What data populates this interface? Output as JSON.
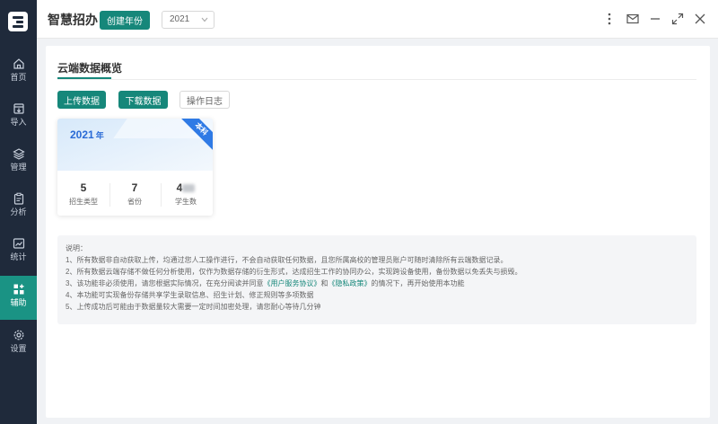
{
  "app": {
    "title": "智慧招办",
    "create_year_label": "创建年份",
    "year_select": "2021"
  },
  "sidebar": {
    "items": [
      {
        "label": "首页",
        "icon": "home-icon"
      },
      {
        "label": "导入",
        "icon": "import-icon"
      },
      {
        "label": "管理",
        "icon": "layers-icon"
      },
      {
        "label": "分析",
        "icon": "clipboard-icon"
      },
      {
        "label": "统计",
        "icon": "chart-icon"
      },
      {
        "label": "辅助",
        "icon": "grid-plus-icon",
        "active": true
      },
      {
        "label": "设置",
        "icon": "gear-icon"
      }
    ]
  },
  "main": {
    "section_title": "云端数据概览",
    "upload_label": "上传数据",
    "download_label": "下载数据",
    "log_label": "操作日志",
    "year_card": {
      "year": "2021",
      "year_suffix": "年",
      "ribbon": "本科",
      "stats": [
        {
          "value": "5",
          "label": "招生类型"
        },
        {
          "value": "7",
          "label": "省份"
        },
        {
          "value": "4",
          "label": "学生数"
        }
      ]
    },
    "notes": {
      "heading": "说明：",
      "line1": "1、所有数据非自动获取上传，均通过您人工操作进行，不会自动获取任何数据，且您所属高校的管理员账户可随时清除所有云端数据记录。",
      "line2": "2、所有数据云端存储不做任何分析使用，仅作为数据存储的衍生形式，达成招生工作的协同办公，实现跨设备使用，备份数据以免丢失与损毁。",
      "line3_a": "3、该功能非必须使用，请您根据实际情况，在充分阅读并同意",
      "line3_link1": "《用户服务协议》",
      "line3_b": "和",
      "line3_link2": "《隐私政策》",
      "line3_c": "的情况下，再开始使用本功能",
      "line4": "4、本功能可实现备份存储共享学生录取信息、招生计划、修正规则等多项数据",
      "line5": "5、上传成功后可能由于数据量较大需要一定时间加密处理，请您耐心等待几分钟"
    }
  },
  "colors": {
    "accent": "#16877a",
    "sidebar_bg": "#1f2a3b",
    "active_nav": "#1a9384",
    "ribbon": "#2f7ae5",
    "year_text": "#2a6bd6"
  }
}
